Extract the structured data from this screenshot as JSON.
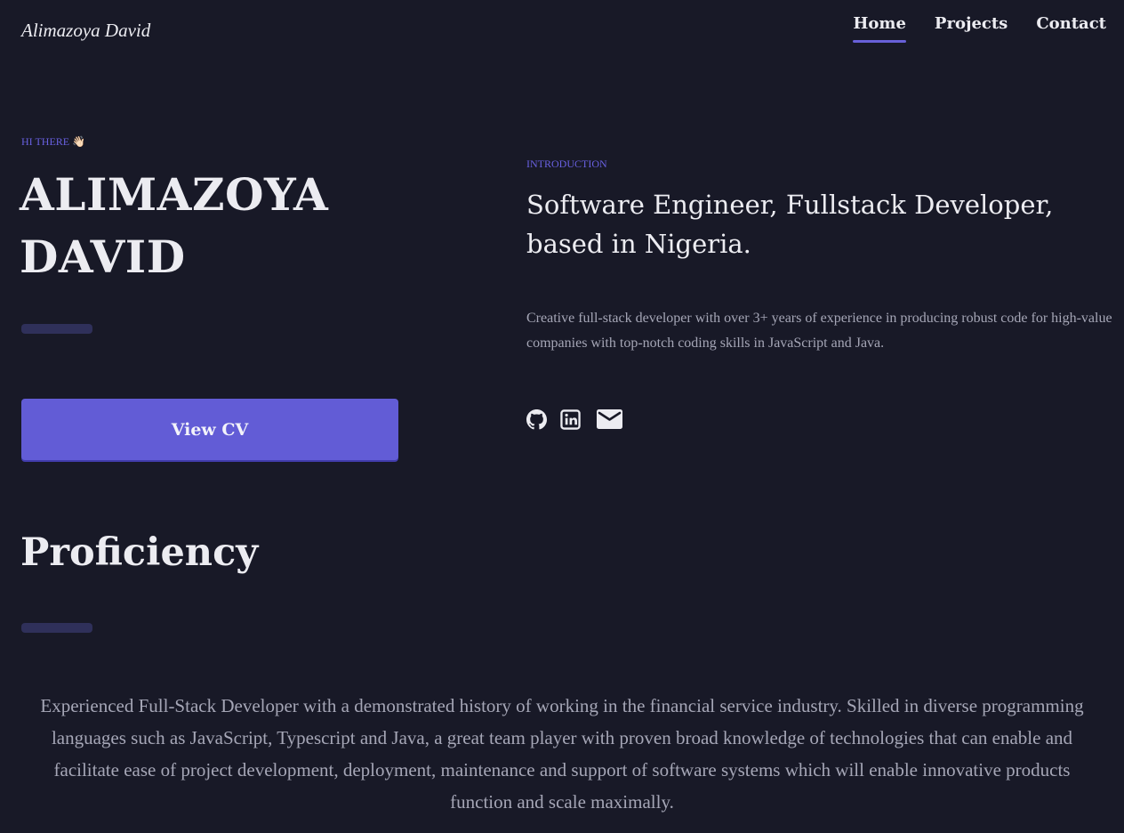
{
  "header": {
    "brand": "Alimazoya David",
    "nav": [
      {
        "label": "Home",
        "active": true
      },
      {
        "label": "Projects",
        "active": false
      },
      {
        "label": "Contact",
        "active": false
      }
    ]
  },
  "hero": {
    "greeting": "HI THERE 👋🏻",
    "name_line1": "ALIMAZOYA",
    "name_line2": "DAVID",
    "cv_button": "View CV"
  },
  "intro": {
    "eyebrow": "INTRODUCTION",
    "heading": "Software Engineer, Fullstack Developer, based in Nigeria.",
    "body": "Creative full-stack developer with over 3+ years of experience in producing robust code for high-value companies with top-notch coding skills in JavaScript and Java.",
    "socials": [
      "github-icon",
      "linkedin-icon",
      "mail-icon"
    ]
  },
  "proficiency": {
    "title": "Proficiency",
    "body": "Experienced Full-Stack Developer with a demonstrated history of working in the financial service industry. Skilled in diverse programming languages such as JavaScript, Typescript and Java, a great team player with proven broad knowledge of technologies that can enable and facilitate ease of project development, deployment, maintenance and support of software systems which will enable innovative products function and scale maximally."
  },
  "colors": {
    "background": "#181927",
    "accent": "#625cd6",
    "divider": "#2f305a",
    "muted_text": "#a5a6b6"
  }
}
